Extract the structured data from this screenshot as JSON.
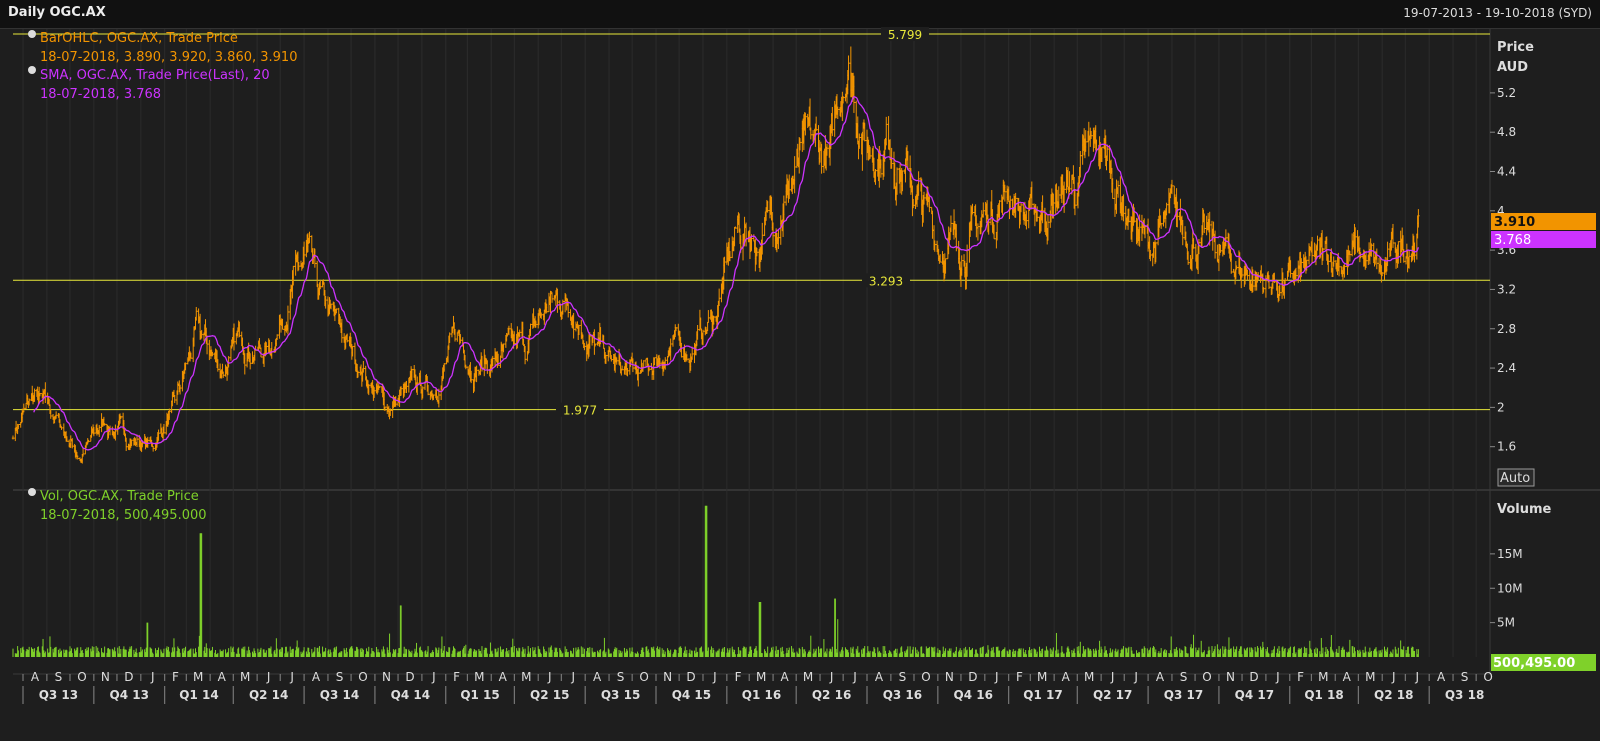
{
  "window": {
    "title": "Daily OGC.AX",
    "date_range": "19-07-2013 - 19-10-2018 (SYD)"
  },
  "colors": {
    "background": "#1e1e1e",
    "price_bar": "#f29400",
    "sma": "#cc33ff",
    "volume": "#7fd12a",
    "hline": "#e8e83a",
    "grid": "#2c2c2c"
  },
  "price_panel": {
    "legend": [
      {
        "label": "BarOHLC, OGC.AX, Trade Price",
        "value": "18-07-2018, 3.890, 3.920, 3.860, 3.910"
      },
      {
        "label": "SMA, OGC.AX, Trade Price(Last),  20",
        "value": "18-07-2018, 3.768"
      }
    ],
    "axis_title": [
      "Price",
      "AUD"
    ],
    "auto_label": "Auto",
    "last_price_tag": "3.910",
    "last_sma_tag": "3.768"
  },
  "volume_panel": {
    "legend": [
      {
        "label": "Vol, OGC.AX, Trade Price",
        "value": "18-07-2018, 500,495.000"
      }
    ],
    "axis_title": "Volume",
    "auto_label": "Auto",
    "last_volume_tag": "500,495.00"
  },
  "chart_data": [
    {
      "type": "bar",
      "subtype": "ohlc",
      "ylim": [
        1.2,
        5.85
      ],
      "yticks": [
        1.6,
        2,
        2.4,
        2.8,
        3.2,
        3.6,
        4,
        4.4,
        4.8,
        5.2
      ],
      "ytick_labels": [
        "1.6",
        "2",
        "2.4",
        "2.8",
        "3.2",
        "3.6",
        "4",
        "4.4",
        "4.8",
        "5.2"
      ],
      "grid": false,
      "horizontal_lines": [
        {
          "value": 5.799,
          "label": "5.799"
        },
        {
          "value": 3.293,
          "label": "3.293"
        },
        {
          "value": 1.977,
          "label": "1.977"
        }
      ],
      "series": [
        {
          "name": "BarOHLC, OGC.AX, Trade Price",
          "style": "ohlc"
        },
        {
          "name": "SMA, OGC.AX, Trade Price(Last),  20",
          "style": "line"
        }
      ],
      "x_start": "2013-07-19",
      "x_end": "2018-10-19",
      "closes_approx": [
        [
          "2013-07-19",
          1.75
        ],
        [
          "2013-08-15",
          2.1
        ],
        [
          "2013-09-15",
          1.85
        ],
        [
          "2013-10-15",
          1.5
        ],
        [
          "2013-11-15",
          1.85
        ],
        [
          "2013-12-15",
          1.7
        ],
        [
          "2014-01-15",
          1.6
        ],
        [
          "2014-02-15",
          2.0
        ],
        [
          "2014-03-15",
          2.75
        ],
        [
          "2014-04-15",
          2.4
        ],
        [
          "2014-05-15",
          2.7
        ],
        [
          "2014-06-15",
          2.55
        ],
        [
          "2014-07-15",
          3.25
        ],
        [
          "2014-08-05",
          3.45
        ],
        [
          "2014-08-20",
          3.05
        ],
        [
          "2014-09-15",
          2.75
        ],
        [
          "2014-10-15",
          2.4
        ],
        [
          "2014-11-15",
          2.0
        ],
        [
          "2014-12-15",
          2.15
        ],
        [
          "2015-01-15",
          2.2
        ],
        [
          "2015-02-15",
          2.7
        ],
        [
          "2015-03-15",
          2.45
        ],
        [
          "2015-04-15",
          2.5
        ],
        [
          "2015-05-15",
          2.6
        ],
        [
          "2015-06-15",
          3.05
        ],
        [
          "2015-07-15",
          3.1
        ],
        [
          "2015-08-15",
          2.6
        ],
        [
          "2015-09-15",
          2.35
        ],
        [
          "2015-10-15",
          2.3
        ],
        [
          "2015-11-15",
          2.6
        ],
        [
          "2015-12-15",
          2.6
        ],
        [
          "2016-01-15",
          2.9
        ],
        [
          "2016-02-15",
          3.8
        ],
        [
          "2016-03-15",
          3.7
        ],
        [
          "2016-04-15",
          4.2
        ],
        [
          "2016-05-15",
          4.55
        ],
        [
          "2016-06-15",
          4.5
        ],
        [
          "2016-07-05",
          5.65
        ],
        [
          "2016-08-01",
          4.7
        ],
        [
          "2016-09-01",
          4.75
        ],
        [
          "2016-10-01",
          4.2
        ],
        [
          "2016-11-01",
          3.7
        ],
        [
          "2016-12-01",
          3.65
        ],
        [
          "2017-01-01",
          3.9
        ],
        [
          "2017-02-01",
          4.25
        ],
        [
          "2017-03-01",
          3.9
        ],
        [
          "2017-04-01",
          4.1
        ],
        [
          "2017-05-01",
          4.3
        ],
        [
          "2017-06-01",
          4.6
        ],
        [
          "2017-07-01",
          4.1
        ],
        [
          "2017-08-01",
          3.6
        ],
        [
          "2017-09-01",
          3.85
        ],
        [
          "2017-10-01",
          3.75
        ],
        [
          "2017-11-01",
          3.55
        ],
        [
          "2017-12-01",
          3.4
        ],
        [
          "2018-01-01",
          3.3
        ],
        [
          "2018-02-01",
          3.25
        ],
        [
          "2018-03-01",
          3.4
        ],
        [
          "2018-04-01",
          3.55
        ],
        [
          "2018-05-01",
          3.55
        ],
        [
          "2018-06-01",
          3.3
        ],
        [
          "2018-07-18",
          3.91
        ]
      ]
    },
    {
      "type": "bar",
      "subtype": "volume",
      "series": [
        {
          "name": "Vol, OGC.AX, Trade Price"
        }
      ],
      "ylim": [
        0,
        24000000
      ],
      "yticks": [
        5000000,
        10000000,
        15000000
      ],
      "ytick_labels": [
        "5M",
        "10M",
        "15M"
      ],
      "baseline_volume": 1000000,
      "spikes": [
        [
          "2014-03-20",
          18000000
        ],
        [
          "2014-12-05",
          7500000
        ],
        [
          "2014-01-10",
          5000000
        ],
        [
          "2016-01-05",
          22000000
        ],
        [
          "2016-03-15",
          8000000
        ],
        [
          "2016-06-20",
          8500000
        ],
        [
          "2016-06-25",
          5500000
        ]
      ]
    },
    {
      "type": "axis",
      "month_labels": [
        "A",
        "S",
        "O",
        "N",
        "D",
        "J",
        "F",
        "M",
        "A",
        "M",
        "J",
        "J",
        "A",
        "S",
        "O",
        "N",
        "D",
        "J",
        "F",
        "M",
        "A",
        "M",
        "J",
        "J",
        "A",
        "S",
        "O",
        "N",
        "D",
        "J",
        "F",
        "M",
        "A",
        "M",
        "J",
        "J",
        "A",
        "S",
        "O",
        "N",
        "D",
        "J",
        "F",
        "M",
        "A",
        "M",
        "J",
        "J",
        "A",
        "S",
        "O",
        "N",
        "D",
        "J",
        "F",
        "M",
        "A",
        "M",
        "J",
        "J",
        "A",
        "S",
        "O"
      ],
      "quarter_labels": [
        "Q3 13",
        "Q4 13",
        "Q1 14",
        "Q2 14",
        "Q3 14",
        "Q4 14",
        "Q1 15",
        "Q2 15",
        "Q3 15",
        "Q4 15",
        "Q1 16",
        "Q2 16",
        "Q3 16",
        "Q4 16",
        "Q1 17",
        "Q2 17",
        "Q3 17",
        "Q4 17",
        "Q1 18",
        "Q2 18",
        "Q3 18"
      ]
    }
  ]
}
